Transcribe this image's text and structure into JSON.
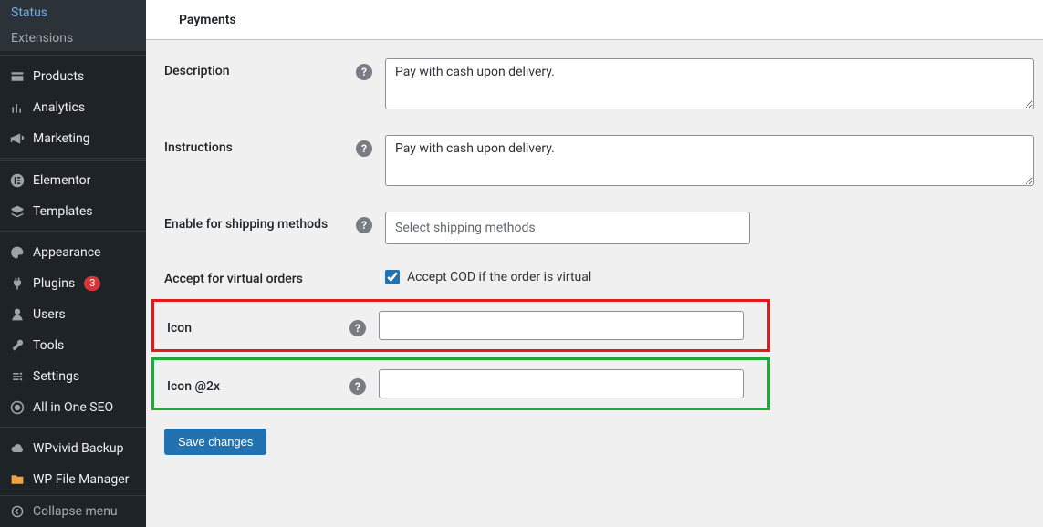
{
  "sidebar": {
    "sub": {
      "status": "Status",
      "extensions": "Extensions"
    },
    "items": [
      {
        "label": "Products"
      },
      {
        "label": "Analytics"
      },
      {
        "label": "Marketing"
      },
      {
        "label": "Elementor"
      },
      {
        "label": "Templates"
      },
      {
        "label": "Appearance"
      },
      {
        "label": "Plugins",
        "badge": "3"
      },
      {
        "label": "Users"
      },
      {
        "label": "Tools"
      },
      {
        "label": "Settings"
      },
      {
        "label": "All in One SEO"
      },
      {
        "label": "WPvivid Backup"
      },
      {
        "label": "WP File Manager"
      }
    ],
    "collapse": "Collapse menu"
  },
  "tabs": {
    "payments": "Payments"
  },
  "form": {
    "description": {
      "label": "Description",
      "value": "Pay with cash upon delivery."
    },
    "instructions": {
      "label": "Instructions",
      "value": "Pay with cash upon delivery."
    },
    "shipping": {
      "label": "Enable for shipping methods",
      "placeholder": "Select shipping methods"
    },
    "virtual": {
      "label": "Accept for virtual orders",
      "checkbox_label": "Accept COD if the order is virtual"
    },
    "icon": {
      "label": "Icon"
    },
    "icon2x": {
      "label": "Icon @2x"
    },
    "save": "Save changes",
    "help_glyph": "?"
  }
}
